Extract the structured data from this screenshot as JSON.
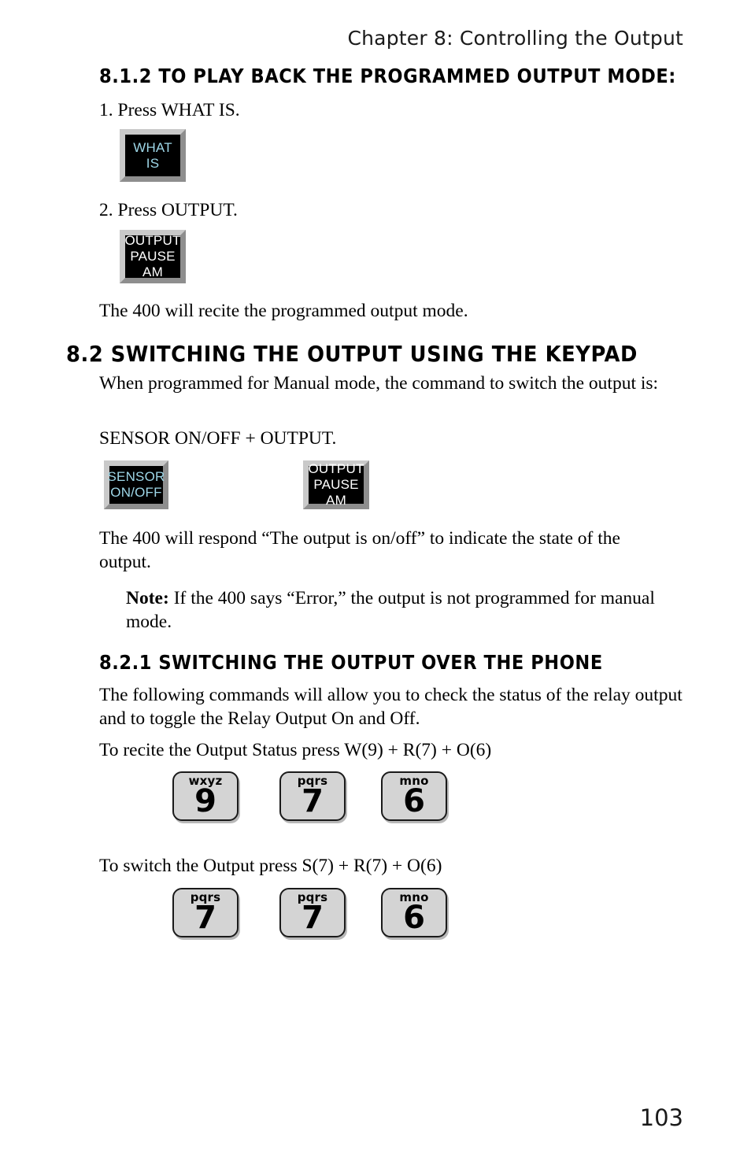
{
  "page": {
    "running_head": "Chapter 8: Controlling the Output",
    "folio": "103"
  },
  "sections": {
    "s812_heading": "8.1.2 TO PLAY BACK THE PROGRAMMED OUTPUT MODE:",
    "step1": "1. Press WHAT IS.",
    "step2": "2. Press OUTPUT.",
    "recite_line": "The 400 will recite the programmed output mode.",
    "s82_heading": "8.2 SWITCHING THE OUTPUT USING THE KEYPAD",
    "manual_mode_para": "When programmed for Manual mode, the command to switch the output is:",
    "command_line": "SENSOR ON/OFF + OUTPUT.",
    "respond_para": "The 400 will respond “The output is on/off” to indicate the state of the output.",
    "note_label": "Note:",
    "note_text": " If the 400 says “Error,” the output is not programmed for manual mode.",
    "s821_heading": "8.2.1 SWITCHING THE OUTPUT OVER THE PHONE",
    "phone_para": "The following commands will allow you to check the status of the relay output and to toggle the Relay Output On and Off.",
    "recite_status_line": "To recite the Output Status press W(9) + R(7) + O(6)",
    "switch_output_line": "To switch the Output press S(7) + R(7) + O(6)"
  },
  "device_buttons": {
    "what_is": {
      "lines": [
        "WHAT",
        "IS"
      ],
      "text_color": "#9ed7e8",
      "bg": "#000000"
    },
    "output_pause_am_1": {
      "lines": [
        "OUTPUT",
        "PAUSE",
        "AM"
      ],
      "text_color": "#ffffff",
      "bg": "#000000"
    },
    "sensor_on_off": {
      "lines": [
        "SENSOR",
        "ON/OFF"
      ],
      "text_color": "#9ed7e8",
      "bg": "#000000"
    },
    "output_pause_am_2": {
      "lines": [
        "OUTPUT",
        "PAUSE",
        "AM"
      ],
      "text_color": "#ffffff",
      "bg": "#000000"
    }
  },
  "keypad_rows": [
    {
      "name": "recite-status-keys",
      "keys": [
        {
          "letters": "wxyz",
          "digit": "9"
        },
        {
          "letters": "pqrs",
          "digit": "7"
        },
        {
          "letters": "mno",
          "digit": "6"
        }
      ]
    },
    {
      "name": "switch-output-keys",
      "keys": [
        {
          "letters": "pqrs",
          "digit": "7"
        },
        {
          "letters": "pqrs",
          "digit": "7"
        },
        {
          "letters": "mno",
          "digit": "6"
        }
      ]
    }
  ]
}
